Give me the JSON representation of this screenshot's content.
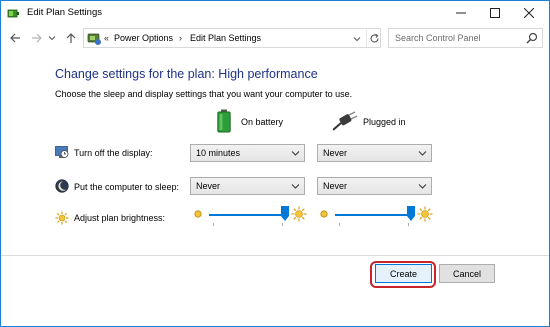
{
  "window": {
    "title": "Edit Plan Settings"
  },
  "address": {
    "prefix": "«",
    "crumbs": [
      "Power Options",
      "Edit Plan Settings"
    ],
    "separator": "›"
  },
  "search": {
    "placeholder": "Search Control Panel"
  },
  "main": {
    "heading": "Change settings for the plan: High performance",
    "subtext": "Choose the sleep and display settings that you want your computer to use.",
    "columns": {
      "on_battery": "On battery",
      "plugged_in": "Plugged in"
    },
    "rows": {
      "display": {
        "label": "Turn off the display:",
        "battery_value": "10 minutes",
        "plugged_value": "Never"
      },
      "sleep": {
        "label": "Put the computer to sleep:",
        "battery_value": "Never",
        "plugged_value": "Never"
      },
      "brightness": {
        "label": "Adjust plan brightness:",
        "battery_level": 1.0,
        "plugged_level": 1.0
      }
    }
  },
  "buttons": {
    "create": "Create",
    "cancel": "Cancel"
  },
  "colors": {
    "heading": "#1e3287",
    "accent": "#0078d7",
    "highlight_ring": "#c9242c",
    "window_border": "#1c7fd6"
  },
  "icons": {
    "app": "power-options-icon",
    "back": "arrow-left-icon",
    "forward": "arrow-right-icon",
    "recent": "chevron-down-icon",
    "up": "arrow-up-icon",
    "refresh": "refresh-icon",
    "search": "search-icon",
    "battery": "battery-icon",
    "plug": "power-plug-icon",
    "display": "monitor-clock-icon",
    "sleep": "moon-icon",
    "brightness": "sun-icon"
  }
}
